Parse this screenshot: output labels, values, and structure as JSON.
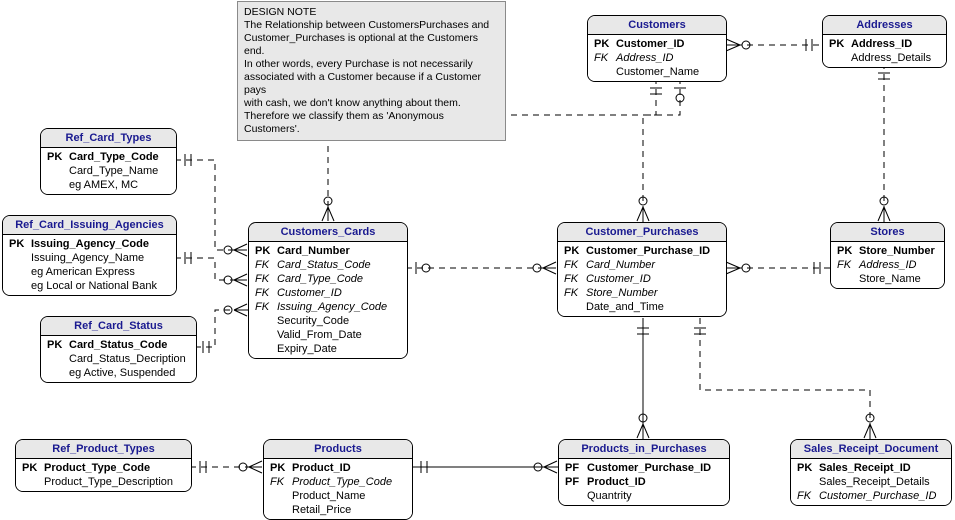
{
  "note": {
    "title": "DESIGN NOTE",
    "l1": " The Relationship between CustomersPurchases and",
    "l2": "Customer_Purchases is optional at the Customers end.",
    "l3": "In other words, every Purchase is not necessarily",
    "l4": "associated with a Customer because if a Customer pays",
    "l5": "with cash, we don't know anything about them.",
    "l6": "Therefore we classify them as 'Anonymous Customers'."
  },
  "entities": {
    "customers": {
      "title": "Customers",
      "pk": "Customer_ID",
      "pk_k": "PK",
      "fk": "Address_ID",
      "fk_k": "FK",
      "f1": "Customer_Name"
    },
    "addresses": {
      "title": "Addresses",
      "pk": "Address_ID",
      "pk_k": "PK",
      "f1": "Address_Details"
    },
    "ref_card_types": {
      "title": "Ref_Card_Types",
      "pk": "Card_Type_Code",
      "pk_k": "PK",
      "f1": "Card_Type_Name",
      "f2": "eg AMEX, MC"
    },
    "ref_card_issuing_agencies": {
      "title": "Ref_Card_Issuing_Agencies",
      "pk": "Issuing_Agency_Code",
      "pk_k": "PK",
      "f1": "Issuing_Agency_Name",
      "f2": "eg American Express",
      "f3": "eg Local or National Bank"
    },
    "ref_card_status": {
      "title": "Ref_Card_Status",
      "pk": "Card_Status_Code",
      "pk_k": "PK",
      "f1": "Card_Status_Decription",
      "f2": "eg Active, Suspended"
    },
    "customers_cards": {
      "title": "Customers_Cards",
      "pk": "Card_Number",
      "pk_k": "PK",
      "fk1": "Card_Status_Code",
      "fk1_k": "FK",
      "fk2": "Card_Type_Code",
      "fk2_k": "FK",
      "fk3": "Customer_ID",
      "fk3_k": "FK",
      "fk4": "Issuing_Agency_Code",
      "fk4_k": "FK",
      "f1": "Security_Code",
      "f2": "Valid_From_Date",
      "f3": "Expiry_Date"
    },
    "customer_purchases": {
      "title": "Customer_Purchases",
      "pk": "Customer_Purchase_ID",
      "pk_k": "PK",
      "fk1": "Card_Number",
      "fk1_k": "FK",
      "fk2": "Customer_ID",
      "fk2_k": "FK",
      "fk3": "Store_Number",
      "fk3_k": "FK",
      "f1": "Date_and_Time"
    },
    "stores": {
      "title": "Stores",
      "pk": "Store_Number",
      "pk_k": "PK",
      "fk": "Address_ID",
      "fk_k": "FK",
      "f1": "Store_Name"
    },
    "ref_product_types": {
      "title": "Ref_Product_Types",
      "pk": "Product_Type_Code",
      "pk_k": "PK",
      "f1": "Product_Type_Description"
    },
    "products": {
      "title": "Products",
      "pk": "Product_ID",
      "pk_k": "PK",
      "fk": "Product_Type_Code",
      "fk_k": "FK",
      "f1": "Product_Name",
      "f2": "Retail_Price"
    },
    "products_in_purchases": {
      "title": "Products_in_Purchases",
      "pf1": "Customer_Purchase_ID",
      "pf1_k": "PF",
      "pf2": "Product_ID",
      "pf2_k": "PF",
      "f1": "Quantrity"
    },
    "sales_receipt_document": {
      "title": "Sales_Receipt_Document",
      "pk": "Sales_Receipt_ID",
      "pk_k": "PK",
      "f1": "Sales_Receipt_Details",
      "fk": "Customer_Purchase_ID",
      "fk_k": "FK"
    }
  }
}
